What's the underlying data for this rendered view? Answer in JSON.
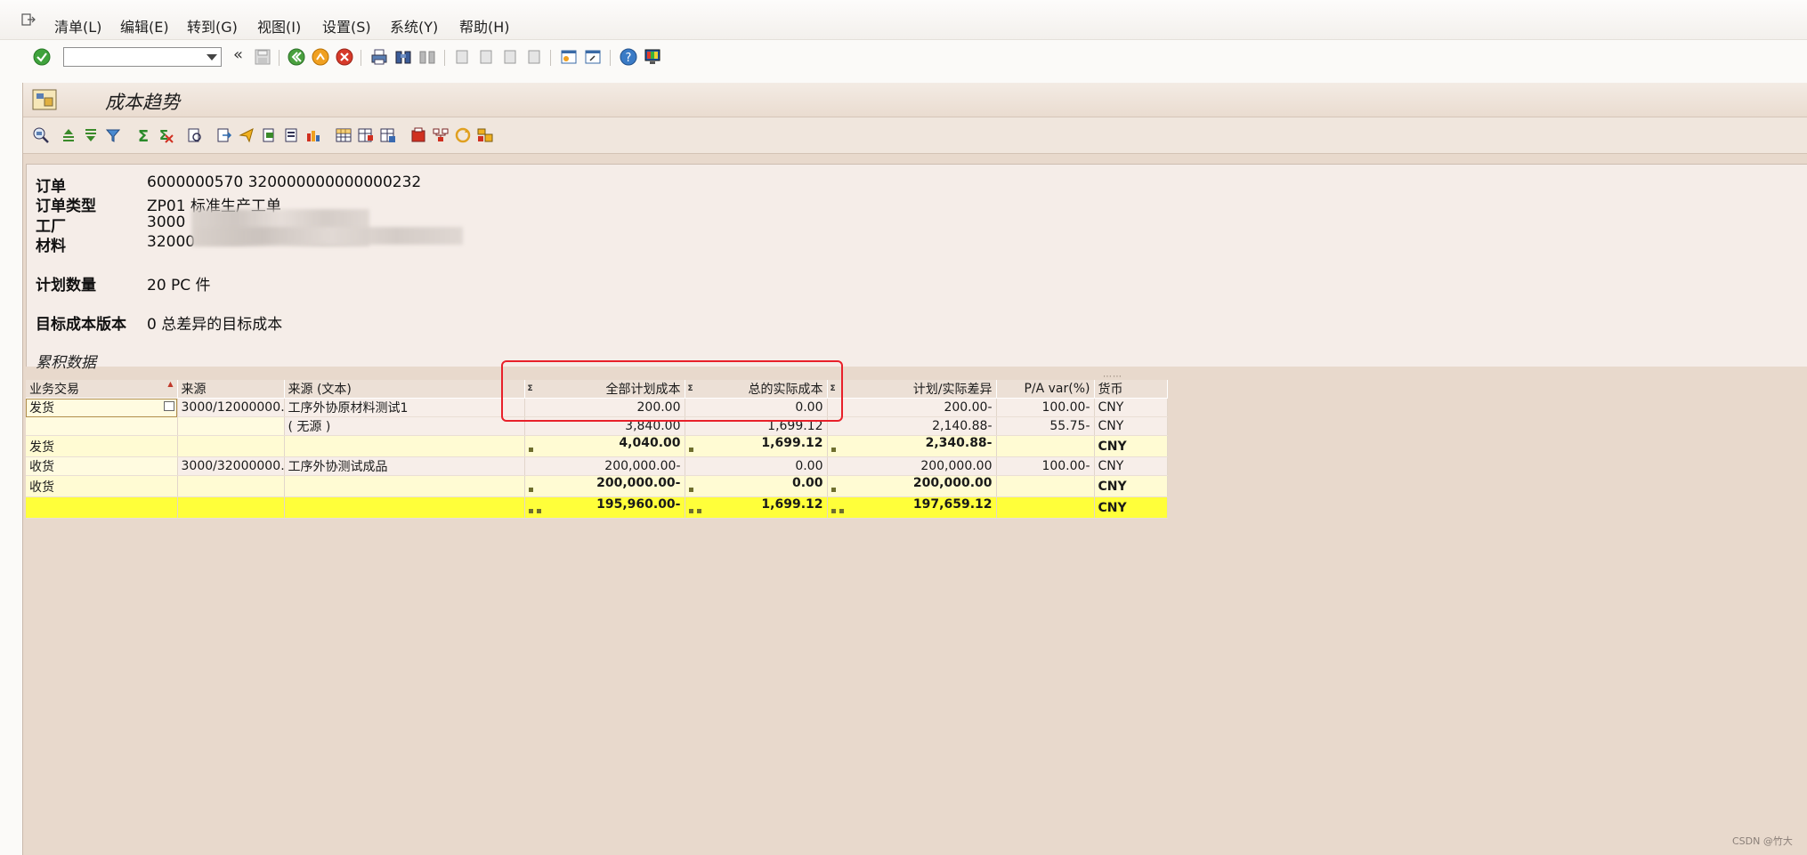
{
  "menu": [
    "清单(L)",
    "编辑(E)",
    "转到(G)",
    "视图(I)",
    "设置(S)",
    "系统(Y)",
    "帮助(H)"
  ],
  "toolbar": {
    "command_value": "",
    "nav_back": "«"
  },
  "window": {
    "title": "成本趋势"
  },
  "header": {
    "order_label": "订单",
    "order_value": "6000000570 320000000000000232",
    "order_type_label": "订单类型",
    "order_type_value": "ZP01 标准生产工单",
    "plant_label": "工厂",
    "plant_value": "3000 ",
    "material_label": "材料",
    "material_value": "32000",
    "planned_qty_label": "计划数量",
    "planned_qty_value": "20 PC 件",
    "target_version_label": "目标成本版本",
    "target_version_value": "0 总差异的目标成本",
    "cumulative_label": "累积数据"
  },
  "grid": {
    "columns": [
      "业务交易",
      "来源",
      "来源 (文本)",
      "全部计划成本",
      "总的实际成本",
      "计划/实际差异",
      "P/A var(%)",
      "货币"
    ],
    "sigma": "Σ",
    "rows": [
      {
        "type": "data",
        "tx": "发货",
        "src": "3000/12000000…",
        "src_text": "工序外协原材料测试1",
        "plan": "200.00",
        "actual": "0.00",
        "diff": "200.00-",
        "pct": "100.00-",
        "cur": "CNY"
      },
      {
        "type": "data",
        "tx": "",
        "src": "",
        "src_text": "( 无源 )",
        "plan": "3,840.00",
        "actual": "1,699.12",
        "diff": "2,140.88-",
        "pct": "55.75-",
        "cur": "CNY"
      },
      {
        "type": "sub",
        "tx": "发货",
        "src": "",
        "src_text": "",
        "plan": "4,040.00",
        "actual": "1,699.12",
        "diff": "2,340.88-",
        "pct": "",
        "cur": "CNY"
      },
      {
        "type": "data",
        "tx": "收货",
        "src": "3000/32000000…",
        "src_text": "工序外协测试成品",
        "plan": "200,000.00-",
        "actual": "0.00",
        "diff": "200,000.00",
        "pct": "100.00-",
        "cur": "CNY"
      },
      {
        "type": "sub",
        "tx": "收货",
        "src": "",
        "src_text": "",
        "plan": "200,000.00-",
        "actual": "0.00",
        "diff": "200,000.00",
        "pct": "",
        "cur": "CNY"
      },
      {
        "type": "total",
        "tx": "",
        "src": "",
        "src_text": "",
        "plan": "195,960.00-",
        "actual": "1,699.12",
        "diff": "197,659.12",
        "pct": "",
        "cur": "CNY"
      }
    ]
  },
  "watermark": "CSDN @竹大",
  "colors": {
    "background": "#e8d9cc",
    "total_row": "#ffff3a",
    "subtotal_row": "#fffbd3",
    "highlight_box": "#e8202a"
  }
}
